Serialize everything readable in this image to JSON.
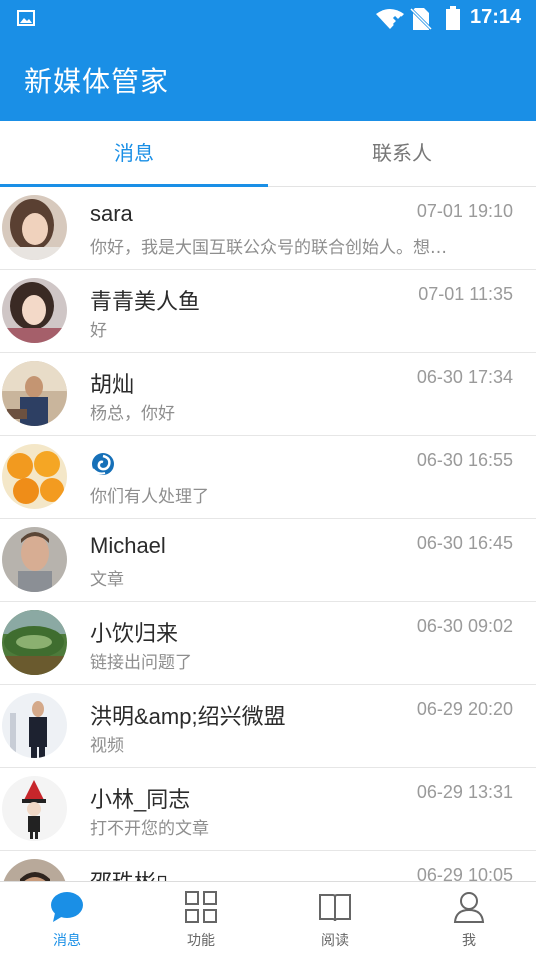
{
  "status_bar": {
    "time": "17:14",
    "icons": [
      "gallery-icon",
      "wifi-icon",
      "no-sim-icon",
      "battery-icon"
    ]
  },
  "app_bar": {
    "title": "新媒体管家"
  },
  "tabs": [
    {
      "label": "消息",
      "active": true
    },
    {
      "label": "联系人",
      "active": false
    }
  ],
  "conversations": [
    {
      "name": "sara",
      "time": "07-01 19:10",
      "message": "你好，我是大国互联公众号的联合创始人。想…",
      "avatar": "woman-portrait"
    },
    {
      "name": "青青美人鱼",
      "time": "07-01 11:35",
      "message": "好",
      "avatar": "woman-portrait-2"
    },
    {
      "name": "胡灿",
      "time": "06-30 17:34",
      "message": "杨总，你好",
      "avatar": "man-at-desk"
    },
    {
      "name": "",
      "time": "06-30 16:55",
      "message": "你们有人处理了",
      "avatar": "oranges",
      "name_icon": "swirl-logo-icon"
    },
    {
      "name": "Michael",
      "time": "06-30 16:45",
      "message": "文章",
      "avatar": "man-portrait"
    },
    {
      "name": "小饮归来",
      "time": "06-30 09:02",
      "message": "链接出问题了",
      "avatar": "landscape"
    },
    {
      "name": "洪明&amp;绍兴微盟",
      "time": "06-29 20:20",
      "message": "视频",
      "avatar": "man-in-suit"
    },
    {
      "name": "小林_同志",
      "time": "06-29 13:31",
      "message": "打不开您的文章",
      "avatar": "cartoon-figure"
    },
    {
      "name": "邵珠彬▯",
      "time": "06-29 10:05",
      "message": "",
      "avatar": "man-portrait-2"
    }
  ],
  "bottom_nav": [
    {
      "label": "消息",
      "icon": "chat-bubble-icon",
      "active": true
    },
    {
      "label": "功能",
      "icon": "grid-icon",
      "active": false
    },
    {
      "label": "阅读",
      "icon": "book-icon",
      "active": false
    },
    {
      "label": "我",
      "icon": "person-icon",
      "active": false
    }
  ],
  "colors": {
    "primary": "#1a8fe6",
    "text": "#2b2b2b",
    "secondary_text": "#8e8e8e"
  }
}
